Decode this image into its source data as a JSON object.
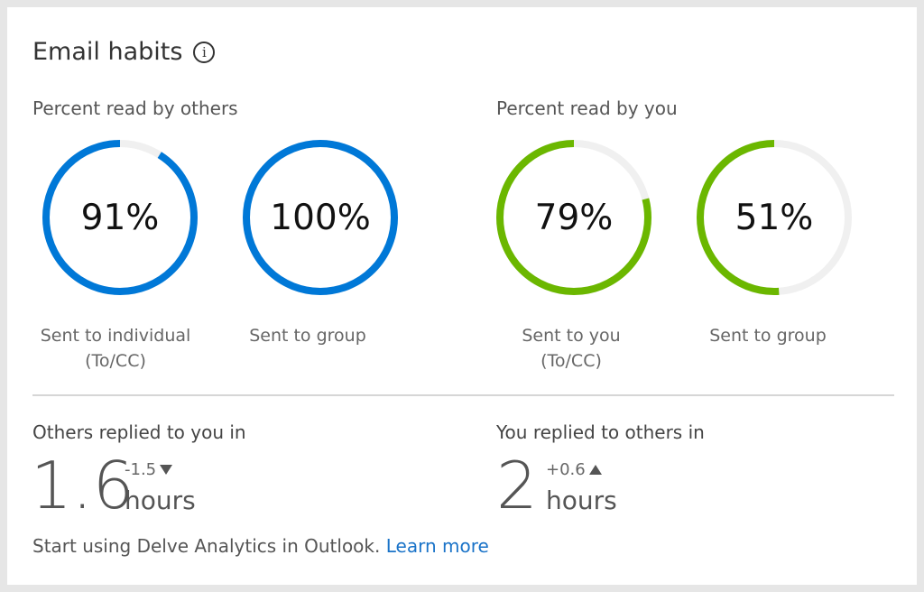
{
  "title": "Email habits",
  "info_icon": "info-icon",
  "read_by_others": {
    "label": "Percent read by others",
    "color": "#0078d7",
    "items": [
      {
        "value": 91,
        "text": "91%",
        "caption1": "Sent to individual",
        "caption2": "(To/CC)"
      },
      {
        "value": 100,
        "text": "100%",
        "caption1": "Sent to group",
        "caption2": ""
      }
    ]
  },
  "read_by_you": {
    "label": "Percent read by you",
    "color": "#6bb700",
    "items": [
      {
        "value": 79,
        "text": "79%",
        "caption1": "Sent to you",
        "caption2": "(To/CC)"
      },
      {
        "value": 51,
        "text": "51%",
        "caption1": "Sent to group",
        "caption2": ""
      }
    ]
  },
  "track_color": "#f0f0f0",
  "others_replied": {
    "label": "Others replied to you in",
    "value": "1.6",
    "delta": "-1.5",
    "delta_icon": "triangle-down-icon",
    "unit": "hours"
  },
  "you_replied": {
    "label": "You replied to others in",
    "value": "2",
    "delta": "+0.6",
    "delta_icon": "triangle-up-icon",
    "unit": "hours"
  },
  "footer": {
    "text": "Start using Delve Analytics in Outlook.",
    "link": "Learn more"
  }
}
